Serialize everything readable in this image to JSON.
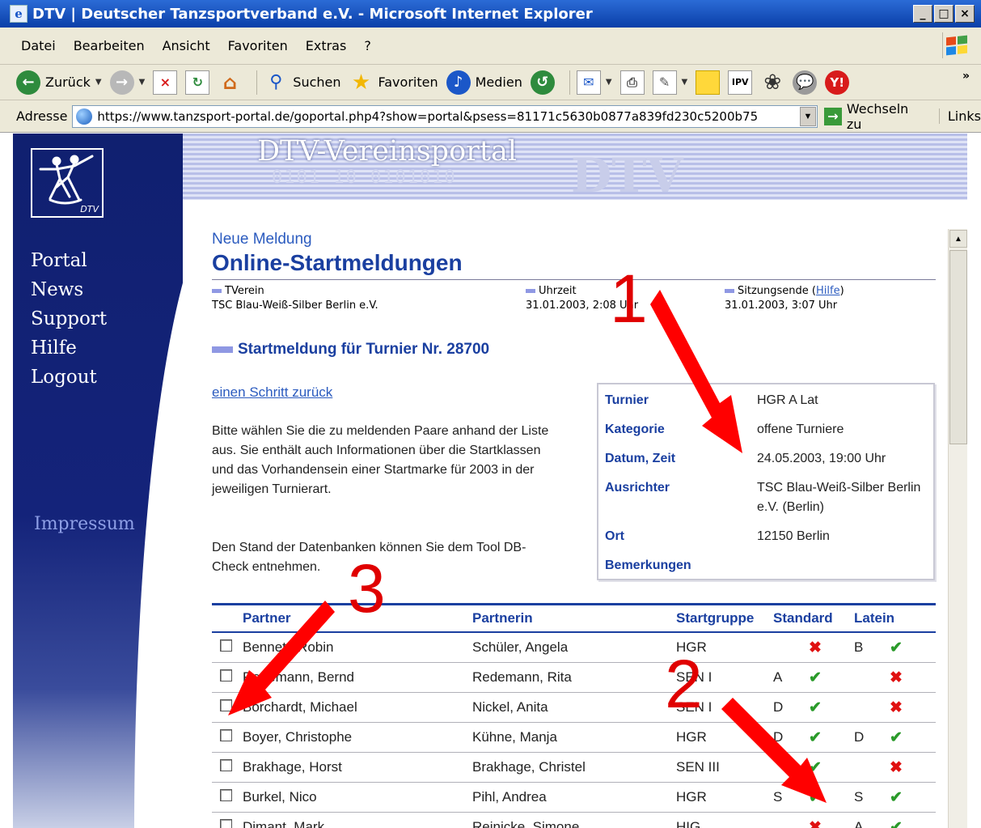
{
  "window": {
    "title": "DTV | Deutscher Tanzsportverband e.V. - Microsoft Internet Explorer",
    "minimize": "_",
    "maximize": "□",
    "close": "×"
  },
  "menu": [
    "Datei",
    "Bearbeiten",
    "Ansicht",
    "Favoriten",
    "Extras",
    "?"
  ],
  "toolbar": {
    "back": "Zurück",
    "search": "Suchen",
    "favorites": "Favoriten",
    "media": "Medien",
    "icons": [
      "back-arrow-icon",
      "forward-arrow-icon",
      "stop-icon",
      "refresh-icon",
      "home-icon",
      "search-icon",
      "star-icon",
      "media-icon",
      "history-icon",
      "mail-icon",
      "print-icon",
      "edit-icon",
      "notes-icon",
      "messenger-icon",
      "yahoo-icon"
    ]
  },
  "address": {
    "label": "Adresse",
    "url": "https://www.tanzsport-portal.de/goportal.php4?show=portal&psess=81171c5630b0877a839fd230c5200b75",
    "go": "Wechseln zu",
    "links": "Links"
  },
  "sidebar": {
    "logo_text": "DTV",
    "nav": [
      "Portal",
      "News",
      "Support",
      "Hilfe",
      "Logout"
    ],
    "impressum": "Impressum"
  },
  "header": {
    "title": "DTV-Vereinsportal",
    "digits": "0101 10 0101010",
    "ghost": "DTV"
  },
  "main": {
    "kicker": "Neue Meldung",
    "heading": "Online-Startmeldungen",
    "meta": [
      {
        "label": "TVerein",
        "value": "TSC Blau-Weiß-Silber Berlin e.V."
      },
      {
        "label": "Uhrzeit",
        "value": "31.01.2003, 2:08 Uhr"
      },
      {
        "label": "Sitzungsende",
        "link": "Hilfe",
        "value": "31.01.2003, 3:07 Uhr"
      }
    ],
    "section": "Startmeldung für Turnier Nr. 28700",
    "back_link": "einen Schritt zurück",
    "para1": "Bitte wählen Sie die zu meldenden Paare anhand der Liste aus. Sie enthält auch Informationen über die Startklassen und das Vorhandensein einer Startmarke für 2003 in der jeweiligen Turnierart.",
    "para2": "Den Stand der Datenbanken können Sie dem Tool DB-Check entnehmen.",
    "info": [
      {
        "key": "Turnier",
        "value": "HGR A Lat"
      },
      {
        "key": "Kategorie",
        "value": "offene Turniere"
      },
      {
        "key": "Datum, Zeit",
        "value": "24.05.2003, 19:00 Uhr"
      },
      {
        "key": "Ausrichter",
        "value": "TSC Blau-Weiß-Silber Berlin e.V. (Berlin)"
      },
      {
        "key": "Ort",
        "value": "12150 Berlin"
      },
      {
        "key": "Bemerkungen",
        "value": ""
      }
    ],
    "table": {
      "headers": [
        "Partner",
        "Partnerin",
        "Startgruppe",
        "Standard",
        "Latein"
      ],
      "rows": [
        {
          "partner": "Bennett, Robin",
          "partnerin": "Schüler, Angela",
          "gruppe": "HGR",
          "std_class": "",
          "std": "no",
          "lat_class": "B",
          "lat": "ok"
        },
        {
          "partner": "Redemann, Bernd",
          "partnerin": "Redemann, Rita",
          "gruppe": "SEN I",
          "std_class": "A",
          "std": "ok",
          "lat_class": "",
          "lat": "no"
        },
        {
          "partner": "Borchardt, Michael",
          "partnerin": "Nickel, Anita",
          "gruppe": "SEN I",
          "std_class": "D",
          "std": "ok",
          "lat_class": "",
          "lat": "no"
        },
        {
          "partner": "Boyer, Christophe",
          "partnerin": "Kühne, Manja",
          "gruppe": "HGR",
          "std_class": "D",
          "std": "ok",
          "lat_class": "D",
          "lat": "ok"
        },
        {
          "partner": "Brakhage, Horst",
          "partnerin": "Brakhage, Christel",
          "gruppe": "SEN III",
          "std_class": "",
          "std": "ok",
          "lat_class": "",
          "lat": "no"
        },
        {
          "partner": "Burkel, Nico",
          "partnerin": "Pihl, Andrea",
          "gruppe": "HGR",
          "std_class": "S",
          "std": "ok",
          "lat_class": "S",
          "lat": "ok"
        },
        {
          "partner": "Dimant, Mark",
          "partnerin": "Reinicke, Simone",
          "gruppe": "HIG",
          "std_class": "",
          "std": "no",
          "lat_class": "A",
          "lat": "ok"
        }
      ]
    }
  },
  "annotations": [
    "1",
    "2",
    "3"
  ],
  "colors": {
    "accent": "#1a3fa0",
    "arrow": "#ff0000",
    "ok": "#2a9a2a",
    "no": "#e01010",
    "sidebar": "#14237a"
  }
}
